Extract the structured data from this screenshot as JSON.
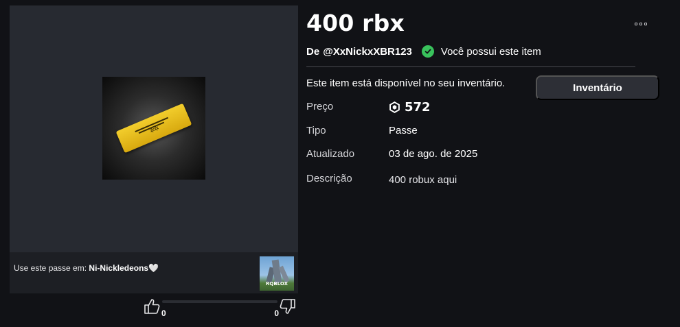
{
  "item": {
    "title": "400 rbx",
    "creator_prefix": "De",
    "creator_handle": "@XxNickxXBR123",
    "owned_text": "Você possui este item",
    "available_text": "Este item está disponível no seu inventário.",
    "inventory_button": "Inventário"
  },
  "details": {
    "price_label": "Preço",
    "price_value": "572",
    "type_label": "Tipo",
    "type_value": "Passe",
    "updated_label": "Atualizado",
    "updated_value": "03 de ago. de 2025",
    "description_label": "Descrição",
    "description_value": "400 robux aqui"
  },
  "preview": {
    "use_prefix": "Use este passe em:",
    "game_name": "Ni-Nickledeons🤍",
    "game_thumb_brand": "RQBLOX"
  },
  "votes": {
    "up": "0",
    "down": "0"
  },
  "icons": {
    "owned": "check-circle-icon",
    "price": "robux-icon",
    "more": "more-options-icon",
    "up": "thumbs-up-icon",
    "down": "thumbs-down-icon"
  },
  "colors": {
    "background": "#111216",
    "panel": "#272a31",
    "owned_green": "#39c25c",
    "button": "#2d2f36"
  }
}
